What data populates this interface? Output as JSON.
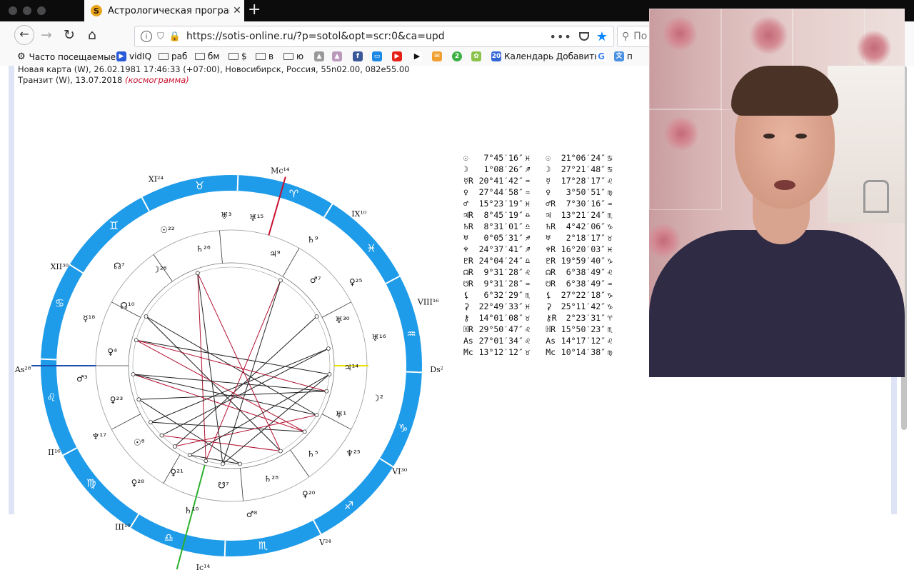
{
  "browser": {
    "tab_title": "Астрологическая программа.",
    "tab_close": "✕",
    "new_tab": "+",
    "url": "https://sotis-online.ru/?p=sotol&opt=scr:0&ca=upd",
    "search_placeholder": "По",
    "bookmarks": [
      {
        "label": "Часто посещаемые",
        "icon": "gear-icon"
      },
      {
        "label": "vidIQ",
        "icon": "vidiq-icon"
      },
      {
        "label": "раб",
        "icon": "folder-icon"
      },
      {
        "label": "бм",
        "icon": "folder-icon"
      },
      {
        "label": "$",
        "icon": "folder-icon"
      },
      {
        "label": "в",
        "icon": "folder-icon"
      },
      {
        "label": "ю",
        "icon": "folder-icon"
      },
      {
        "label": "Календарь Добавить",
        "icon": "calendar-icon"
      },
      {
        "label": "п",
        "icon": "translate-icon"
      }
    ],
    "calendar_day": "20"
  },
  "page": {
    "header_line1": "Новая карта (W), 26.02.1981 17:46:33 (+07:00), Новосибирск, Россия, 55n02.00, 082e55.00",
    "header_line2_prefix": "Транзит (W), 13.07.2018 ",
    "header_line2_link": "(космограмма)"
  },
  "chart": {
    "zodiac_signs": [
      "♉",
      "♈",
      "♓",
      "♒",
      "♑",
      "♐",
      "♏",
      "♎",
      "♍",
      "♌",
      "♋",
      "♊"
    ],
    "house_labels": [
      {
        "text": "Mc¹⁴"
      },
      {
        "text": "XI²⁴"
      },
      {
        "text": "IX¹⁰"
      },
      {
        "text": "XII³⁰"
      },
      {
        "text": "VIII¹⁶"
      },
      {
        "text": "As²⁸"
      },
      {
        "text": "Ds²⁸"
      },
      {
        "text": "II¹⁶"
      },
      {
        "text": "VI³⁰"
      },
      {
        "text": "III¹⁰"
      },
      {
        "text": "V²⁴"
      },
      {
        "text": "Ic¹⁴"
      }
    ],
    "planet_labels": [
      {
        "text": "♅³"
      },
      {
        "text": "♄²⁶"
      },
      {
        "text": "☉²²"
      },
      {
        "text": "☽²⁸"
      },
      {
        "text": "☊⁷"
      },
      {
        "text": "☊¹⁰"
      },
      {
        "text": "☿¹⁸"
      },
      {
        "text": "♀⁴"
      },
      {
        "text": "♂³"
      },
      {
        "text": "♀²³"
      },
      {
        "text": "♆¹⁷"
      },
      {
        "text": "☉⁸"
      },
      {
        "text": "♀²⁸"
      },
      {
        "text": "♀²¹"
      },
      {
        "text": "♄¹⁰"
      },
      {
        "text": "☋⁷"
      },
      {
        "text": "♂⁸"
      },
      {
        "text": "♄²⁸"
      },
      {
        "text": "♀²⁰"
      },
      {
        "text": "♄⁵"
      },
      {
        "text": "♆²⁵"
      },
      {
        "text": "♅¹"
      },
      {
        "text": "☽²"
      },
      {
        "text": "♃¹⁴"
      },
      {
        "text": "♅¹⁶"
      },
      {
        "text": "♅³⁰"
      },
      {
        "text": "♀²⁵"
      },
      {
        "text": "♂⁷"
      },
      {
        "text": "♄⁹"
      },
      {
        "text": "♃⁹"
      },
      {
        "text": "♅¹⁵"
      }
    ]
  },
  "positions": [
    {
      "g1": "☉",
      "v1": " 7°45′16″",
      "s1": "♓",
      "g2": "☉",
      "v2": "21°06′24″",
      "s2": "♋"
    },
    {
      "g1": "☽",
      "v1": " 1°08′26″",
      "s1": "♐",
      "g2": "☽",
      "v2": "27°21′48″",
      "s2": "♋"
    },
    {
      "g1": "☿R",
      "v1": "20°41′42″",
      "s1": "♒",
      "g2": "☿",
      "v2": "17°28′17″",
      "s2": "♌"
    },
    {
      "g1": "♀",
      "v1": "27°44′58″",
      "s1": "♒",
      "g2": "♀",
      "v2": " 3°50′51″",
      "s2": "♍"
    },
    {
      "g1": "♂",
      "v1": "15°23′19″",
      "s1": "♓",
      "g2": "♂R",
      "v2": " 7°30′16″",
      "s2": "♒"
    },
    {
      "g1": "♃R",
      "v1": " 8°45′19″",
      "s1": "♎",
      "g2": "♃",
      "v2": "13°21′24″",
      "s2": "♏"
    },
    {
      "g1": "♄R",
      "v1": " 8°31′01″",
      "s1": "♎",
      "g2": "♄R",
      "v2": " 4°42′06″",
      "s2": "♑"
    },
    {
      "g1": "♅",
      "v1": " 0°05′31″",
      "s1": "♐",
      "g2": "♅",
      "v2": " 2°18′17″",
      "s2": "♉"
    },
    {
      "g1": "♆",
      "v1": "24°37′41″",
      "s1": "♐",
      "g2": "♆R",
      "v2": "16°20′03″",
      "s2": "♓"
    },
    {
      "g1": "♇R",
      "v1": "24°04′24″",
      "s1": "♎",
      "g2": "♇R",
      "v2": "19°59′40″",
      "s2": "♑"
    },
    {
      "g1": "☊R",
      "v1": " 9°31′28″",
      "s1": "♌",
      "g2": "☊R",
      "v2": " 6°38′49″",
      "s2": "♌"
    },
    {
      "g1": "☋R",
      "v1": " 9°31′28″",
      "s1": "♒",
      "g2": "☋R",
      "v2": " 6°38′49″",
      "s2": "♒"
    },
    {
      "g1": "⚸",
      "v1": " 6°32′29″",
      "s1": "♏",
      "g2": "⚸",
      "v2": "27°22′18″",
      "s2": "♑"
    },
    {
      "g1": "⚳",
      "v1": "22°49′33″",
      "s1": "♓",
      "g2": "⚳",
      "v2": "25°11′42″",
      "s2": "♑"
    },
    {
      "g1": "⚷",
      "v1": "14°01′08″",
      "s1": "♉",
      "g2": "⚷R",
      "v2": " 2°23′31″",
      "s2": "♈"
    },
    {
      "g1": "ℍR",
      "v1": "29°50′47″",
      "s1": "♌",
      "g2": "ℍR",
      "v2": "15°50′23″",
      "s2": "♏"
    },
    {
      "g1": "As",
      "v1": "27°01′34″",
      "s1": "♌",
      "g2": "As",
      "v2": "14°17′12″",
      "s2": "♌"
    },
    {
      "g1": "Mc",
      "v1": "13°12′12″",
      "s1": "♉",
      "g2": "Mc",
      "v2": "10°14′38″",
      "s2": "♍"
    }
  ]
}
